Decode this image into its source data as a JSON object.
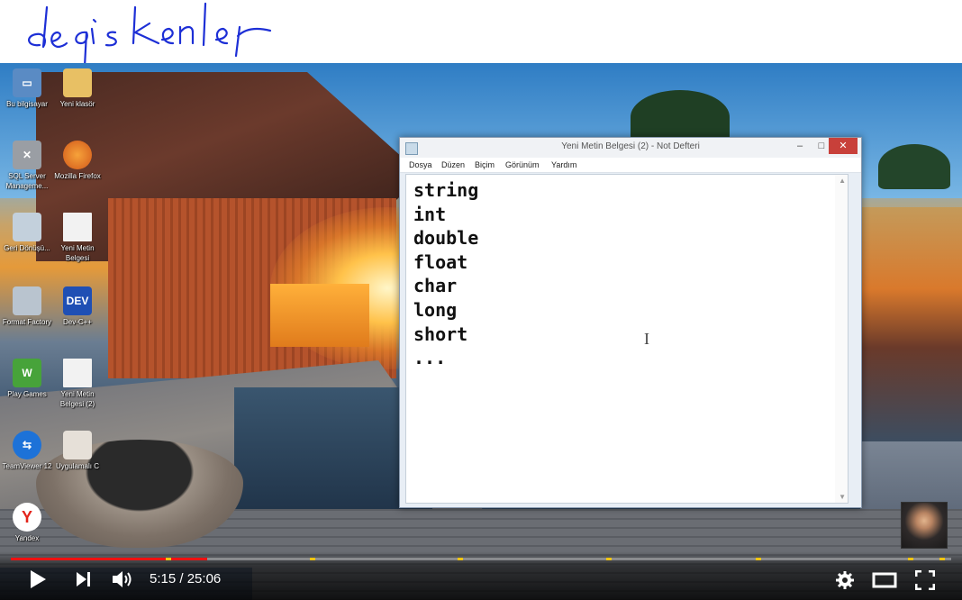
{
  "annotation": {
    "text": "değişkenler"
  },
  "desktop": {
    "icons": [
      {
        "label": "Bu bilgisayar",
        "icon": "computer-icon"
      },
      {
        "label": "Yeni klasör",
        "icon": "folder-icon"
      },
      {
        "label": "SQL Server Manageme...",
        "icon": "sql-server-icon"
      },
      {
        "label": "Mozilla Firefox",
        "icon": "firefox-icon"
      },
      {
        "label": "Geri Dönüşü...",
        "icon": "recycle-bin-icon"
      },
      {
        "label": "Yeni Metin Belgesi",
        "icon": "text-file-icon"
      },
      {
        "label": "Format Factory",
        "icon": "format-factory-icon"
      },
      {
        "label": "Dev-C++",
        "icon": "dev-cpp-icon",
        "badge": "DEV"
      },
      {
        "label": "Play Games",
        "icon": "play-games-icon"
      },
      {
        "label": "Yeni Metin Belgesi (2)",
        "icon": "text-file-icon"
      },
      {
        "label": "TeamViewer 12",
        "icon": "teamviewer-icon"
      },
      {
        "label": "Uygulamalı C",
        "icon": "pdf-icon"
      },
      {
        "label": "Yandex",
        "icon": "yandex-icon",
        "badge": "Y"
      }
    ]
  },
  "notepad": {
    "title": "Yeni Metin Belgesi (2) - Not Defteri",
    "controls": {
      "minimize": "–",
      "maximize": "□",
      "close": "✕"
    },
    "menu": [
      "Dosya",
      "Düzen",
      "Biçim",
      "Görünüm",
      "Yardım"
    ],
    "content_lines": [
      "string",
      "int",
      "double",
      "float",
      "char",
      "long",
      "short",
      "..."
    ],
    "cursor_glyph": "I"
  },
  "player": {
    "time_current": "5:15",
    "time_separator": " / ",
    "time_total": "25:06",
    "progress_fraction": 0.209,
    "chapter_markers": [
      0.168,
      0.321,
      0.478,
      0.636,
      0.795,
      0.957,
      0.99
    ],
    "colors": {
      "played": "#ee1111",
      "marker": "#f1c40f"
    }
  }
}
